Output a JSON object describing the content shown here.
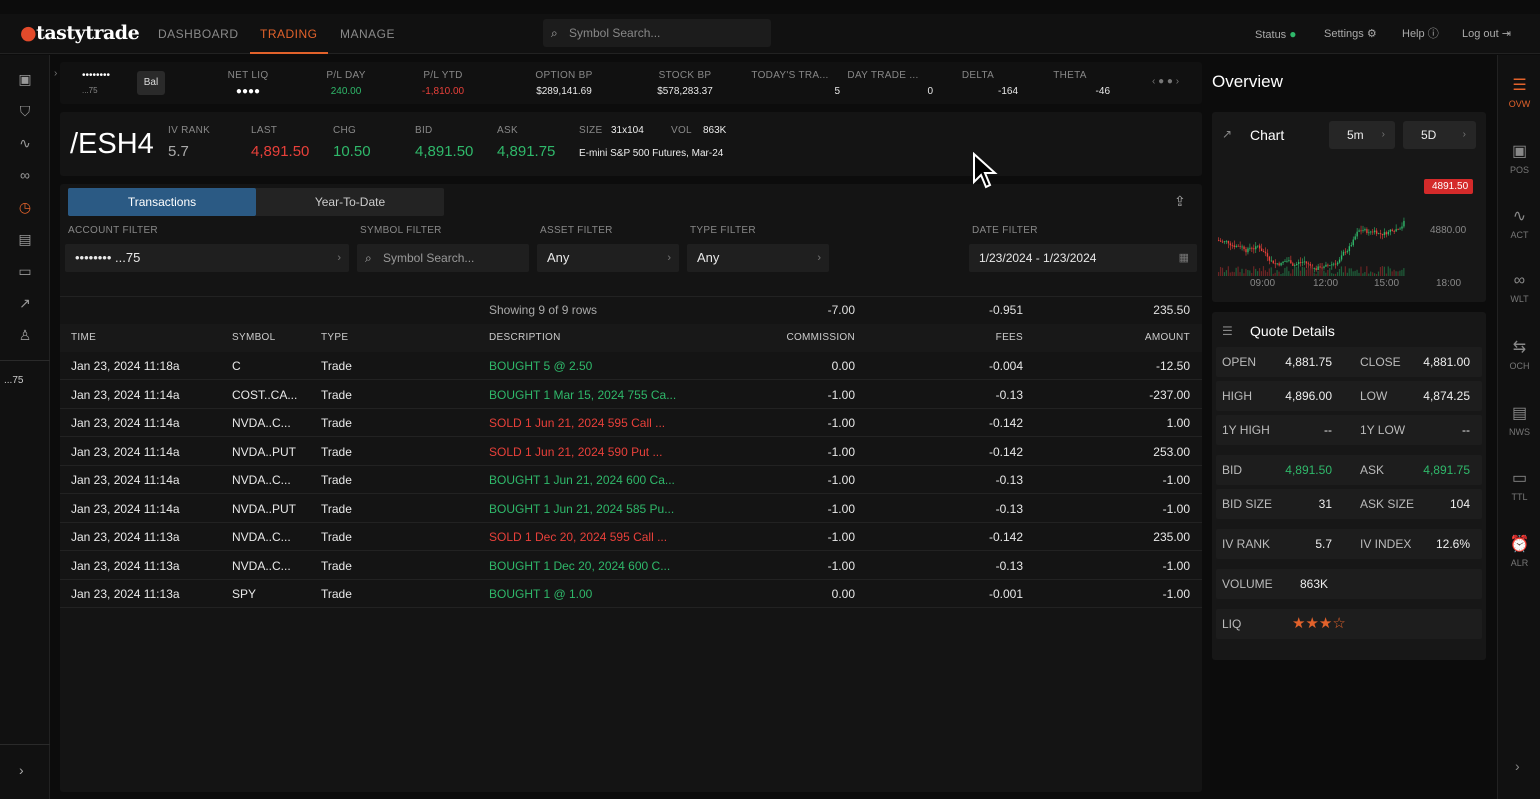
{
  "topbar": {
    "logo": "tastytrade",
    "nav": [
      "DASHBOARD",
      "TRADING",
      "MANAGE"
    ],
    "search_placeholder": "Symbol Search...",
    "status": "Status",
    "settings": "Settings",
    "help": "Help",
    "logout": "Log out"
  },
  "left_account_label": "...75",
  "account": {
    "mask": "••••••••",
    "suffix": "...75",
    "bal_button": "Bal",
    "metrics": [
      {
        "label": "NET LIQ",
        "value": "●●●●",
        "color": "#ffffff"
      },
      {
        "label": "P/L DAY",
        "value": "240.00",
        "color": "#2fb86a"
      },
      {
        "label": "P/L YTD",
        "value": "-1,810.00",
        "color": "#e8403a"
      },
      {
        "label": "OPTION BP",
        "value": "$289,141.69",
        "color": "#e8e8e8"
      },
      {
        "label": "STOCK BP",
        "value": "$578,283.37",
        "color": "#e8e8e8"
      },
      {
        "label": "TODAY'S TRA...",
        "value": "5",
        "color": "#e8e8e8"
      },
      {
        "label": "DAY TRADE ...",
        "value": "0",
        "color": "#e8e8e8"
      },
      {
        "label": "DELTA",
        "value": "-164",
        "color": "#e8e8e8"
      },
      {
        "label": "THETA",
        "value": "-46",
        "color": "#e8e8e8"
      }
    ]
  },
  "symbol": {
    "ticker": "/ESH4",
    "iv_rank_label": "IV RANK",
    "iv_rank": "5.7",
    "last_label": "LAST",
    "last": "4,891.50",
    "chg_label": "CHG",
    "chg": "10.50",
    "bid_label": "BID",
    "bid": "4,891.50",
    "ask_label": "ASK",
    "ask": "4,891.75",
    "size_label": "SIZE",
    "size": "31x104",
    "vol_label": "VOL",
    "vol": "863K",
    "description": "E-mini S&P 500 Futures, Mar-24"
  },
  "tabs": [
    "Transactions",
    "Year-To-Date"
  ],
  "filters": {
    "account_label": "ACCOUNT FILTER",
    "account_value": "••••••••  ...75",
    "symbol_label": "SYMBOL FILTER",
    "symbol_placeholder": "Symbol Search...",
    "asset_label": "ASSET FILTER",
    "asset_value": "Any",
    "type_label": "TYPE FILTER",
    "type_value": "Any",
    "date_label": "DATE FILTER",
    "date_value": "1/23/2024 - 1/23/2024"
  },
  "summary": {
    "showing": "Showing 9 of 9 rows",
    "commission": "-7.00",
    "fees": "-0.951",
    "amount": "235.50"
  },
  "table": {
    "headers": [
      "TIME",
      "SYMBOL",
      "TYPE",
      "DESCRIPTION",
      "COMMISSION",
      "FEES",
      "AMOUNT"
    ],
    "rows": [
      {
        "time": "Jan 23, 2024 11:18a",
        "symbol": "C",
        "type": "Trade",
        "desc": "BOUGHT 5 @ 2.50",
        "side": "buy",
        "commission": "0.00",
        "fees": "-0.004",
        "amount": "-12.50"
      },
      {
        "time": "Jan 23, 2024 11:14a",
        "symbol": "COST..CA...",
        "type": "Trade",
        "desc": "BOUGHT 1 Mar 15, 2024 755 Ca...",
        "side": "buy",
        "commission": "-1.00",
        "fees": "-0.13",
        "amount": "-237.00"
      },
      {
        "time": "Jan 23, 2024 11:14a",
        "symbol": "NVDA..C...",
        "type": "Trade",
        "desc": "SOLD 1 Jun 21, 2024 595 Call ...",
        "side": "sell",
        "commission": "-1.00",
        "fees": "-0.142",
        "amount": "1.00"
      },
      {
        "time": "Jan 23, 2024 11:14a",
        "symbol": "NVDA..PUT",
        "type": "Trade",
        "desc": "SOLD 1 Jun 21, 2024 590 Put ...",
        "side": "sell",
        "commission": "-1.00",
        "fees": "-0.142",
        "amount": "253.00"
      },
      {
        "time": "Jan 23, 2024 11:14a",
        "symbol": "NVDA..C...",
        "type": "Trade",
        "desc": "BOUGHT 1 Jun 21, 2024 600 Ca...",
        "side": "buy",
        "commission": "-1.00",
        "fees": "-0.13",
        "amount": "-1.00"
      },
      {
        "time": "Jan 23, 2024 11:14a",
        "symbol": "NVDA..PUT",
        "type": "Trade",
        "desc": "BOUGHT 1 Jun 21, 2024 585 Pu...",
        "side": "buy",
        "commission": "-1.00",
        "fees": "-0.13",
        "amount": "-1.00"
      },
      {
        "time": "Jan 23, 2024 11:13a",
        "symbol": "NVDA..C...",
        "type": "Trade",
        "desc": "SOLD 1 Dec 20, 2024 595 Call ...",
        "side": "sell",
        "commission": "-1.00",
        "fees": "-0.142",
        "amount": "235.00"
      },
      {
        "time": "Jan 23, 2024 11:13a",
        "symbol": "NVDA..C...",
        "type": "Trade",
        "desc": "BOUGHT 1 Dec 20, 2024 600 C...",
        "side": "buy",
        "commission": "-1.00",
        "fees": "-0.13",
        "amount": "-1.00"
      },
      {
        "time": "Jan 23, 2024 11:13a",
        "symbol": "SPY",
        "type": "Trade",
        "desc": "BOUGHT 1 @ 1.00",
        "side": "buy",
        "commission": "0.00",
        "fees": "-0.001",
        "amount": "-1.00"
      }
    ]
  },
  "overview": {
    "title": "Overview",
    "chart_title": "Chart",
    "interval": "5m",
    "range": "5D",
    "price_tag": "4891.50",
    "y_label": "4880.00",
    "x_labels": [
      "09:00",
      "12:00",
      "15:00",
      "18:00"
    ]
  },
  "quote": {
    "title": "Quote Details",
    "rows": [
      [
        {
          "k": "OPEN",
          "v": "4,881.75"
        },
        {
          "k": "CLOSE",
          "v": "4,881.00"
        }
      ],
      [
        {
          "k": "HIGH",
          "v": "4,896.00"
        },
        {
          "k": "LOW",
          "v": "4,874.25"
        }
      ],
      [
        {
          "k": "1Y HIGH",
          "v": "--"
        },
        {
          "k": "1Y LOW",
          "v": "--"
        }
      ],
      [
        {
          "k": "BID",
          "v": "4,891.50",
          "c": "green"
        },
        {
          "k": "ASK",
          "v": "4,891.75",
          "c": "green"
        }
      ],
      [
        {
          "k": "BID SIZE",
          "v": "31"
        },
        {
          "k": "ASK SIZE",
          "v": "104"
        }
      ],
      [
        {
          "k": "IV RANK",
          "v": "5.7"
        },
        {
          "k": "IV INDEX",
          "v": "12.6%"
        }
      ],
      [
        {
          "k": "VOLUME",
          "v": "863K"
        }
      ],
      [
        {
          "k": "LIQ",
          "v": "★★★☆",
          "c": "orange"
        }
      ]
    ]
  },
  "rightbar": [
    "OVW",
    "POS",
    "ACT",
    "WLT",
    "OCH",
    "NWS",
    "TTL",
    "ALR"
  ]
}
